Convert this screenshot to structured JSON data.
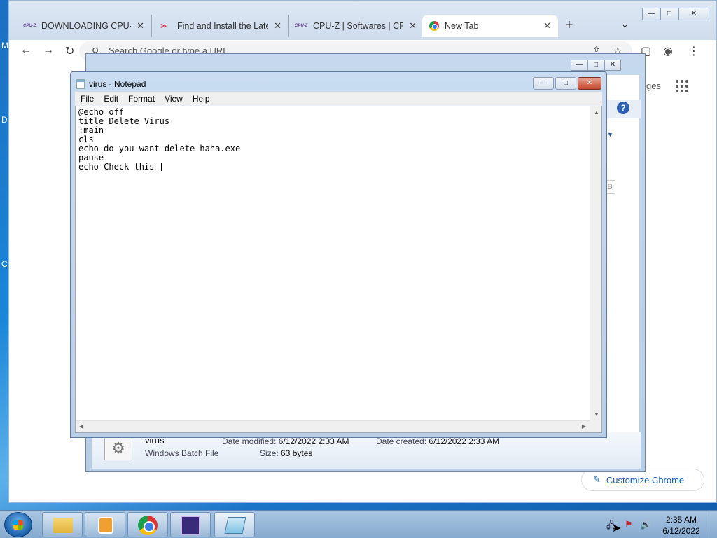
{
  "desktop": {
    "frag_m": "M",
    "frag_d": "D",
    "frag_c": "C"
  },
  "chrome": {
    "tabs": [
      {
        "label": "DOWNLOADING CPU-Z",
        "icon": "cpuz-favicon-icon",
        "favicon_text": "CPU-Z"
      },
      {
        "label": "Find and Install the Late",
        "icon": "tool-favicon-icon"
      },
      {
        "label": "CPU-Z | Softwares | CPU",
        "icon": "cpuz-favicon-icon",
        "favicon_text": "CPU-Z"
      },
      {
        "label": "New Tab",
        "icon": "chrome-favicon-icon"
      }
    ],
    "tab_close": "✕",
    "new_tab": "+",
    "tabs_menu": "⌄",
    "back": "←",
    "forward": "→",
    "reload": "↻",
    "omnibox_placeholder": "Search Google or type a URL",
    "share": "⇪",
    "star": "☆",
    "side_panel": "▢",
    "profile": "◉",
    "menu": "⋮",
    "bg_images_text": "ges",
    "customize_label": "Customize Chrome",
    "customize_icon": "✎",
    "window_controls": {
      "minimize": "—",
      "maximize": "□",
      "close": "✕"
    }
  },
  "explorer": {
    "help": "?",
    "b_label": "B",
    "details": {
      "file_name": "virus",
      "file_type": "Windows Batch File",
      "date_modified_label": "Date modified:",
      "date_modified_value": "6/12/2022 2:33 AM",
      "date_created_label": "Date created:",
      "date_created_value": "6/12/2022 2:33 AM",
      "size_label": "Size:",
      "size_value": "63 bytes"
    }
  },
  "notepad": {
    "title": "virus - Notepad",
    "menu": [
      "File",
      "Edit",
      "Format",
      "View",
      "Help"
    ],
    "content": "@echo off\ntitle Delete Virus\n:main\ncls\necho do you want delete haha.exe\npause\necho Check this "
  },
  "taskbar": {
    "clock_time": "2:35 AM",
    "clock_date": "6/12/2022",
    "tray_network": "🖧",
    "tray_flag": "⚑",
    "tray_volume": "🔊"
  },
  "colors": {
    "desktop": "#1a86d8",
    "chrome_link": "#1a5fb4",
    "notepad_close": "#c8462c"
  }
}
